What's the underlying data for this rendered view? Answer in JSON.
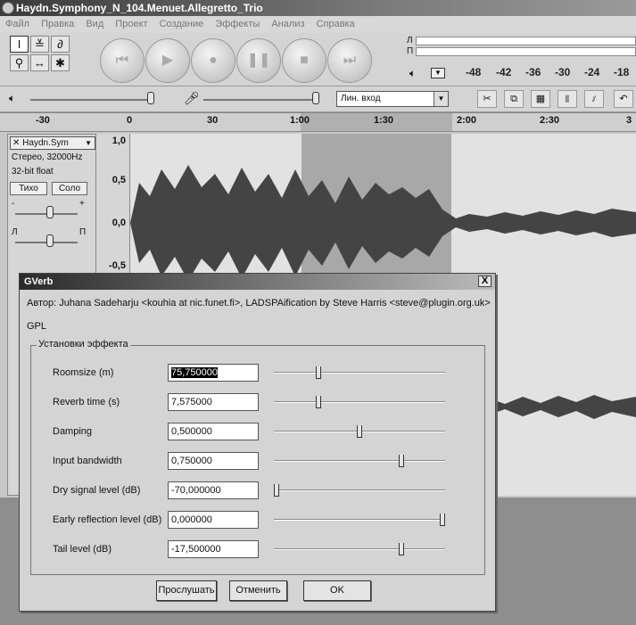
{
  "window": {
    "title": "Haydn.Symphony_N_104.Menuet.Allegretto_Trio"
  },
  "menu": [
    "Файл",
    "Правка",
    "Вид",
    "Проект",
    "Создание",
    "Эффекты",
    "Анализ",
    "Справка"
  ],
  "toolbar": {
    "tools": [
      "I",
      "≚",
      "∂",
      "⚲",
      "↔",
      "✱"
    ],
    "transport": [
      "⏮",
      "▶",
      "●",
      "❚❚",
      "■",
      "⏭"
    ],
    "meter_channels": [
      "Л",
      "П"
    ],
    "meter_ticks": [
      "-48",
      "-42",
      "-36",
      "-30",
      "-24",
      "-18"
    ],
    "input_source": "Лин. вход"
  },
  "ruler": {
    "ticks": [
      "-30",
      "0",
      "30",
      "1:00",
      "1:30",
      "2:00",
      "2:30",
      "3"
    ]
  },
  "track": {
    "name": "Haydn.Sym",
    "info1": "Стерео, 32000Hz",
    "info2": "32-bit float",
    "mute": "Тихо",
    "solo": "Соло",
    "gain_minus": "-",
    "gain_plus": "+",
    "pan_left": "Л",
    "pan_right": "П",
    "scale": [
      "1,0",
      "0,5",
      "0,0",
      "-0,5"
    ]
  },
  "dialog": {
    "title": "GVerb",
    "close": "X",
    "author": "Автор: Juhana Sadeharju <kouhia at nic.funet.fi>, LADSPAification by Steve Harris <steve@plugin.org.uk>",
    "license": "GPL",
    "group_title": "Установки эффекта",
    "params": [
      {
        "label": "Roomsize (m)",
        "value": "75,750000",
        "slider": 0.25
      },
      {
        "label": "Reverb time (s)",
        "value": "7,575000",
        "slider": 0.25
      },
      {
        "label": "Damping",
        "value": "0,500000",
        "slider": 0.5
      },
      {
        "label": "Input bandwidth",
        "value": "0,750000",
        "slider": 0.75
      },
      {
        "label": "Dry signal level (dB)",
        "value": "-70,000000",
        "slider": 0.0
      },
      {
        "label": "Early reflection level (dB)",
        "value": "0,000000",
        "slider": 1.0
      },
      {
        "label": "Tail level (dB)",
        "value": "-17,500000",
        "slider": 0.75
      }
    ],
    "buttons": {
      "preview": "Прослушать",
      "cancel": "Отменить",
      "ok": "OK"
    }
  }
}
